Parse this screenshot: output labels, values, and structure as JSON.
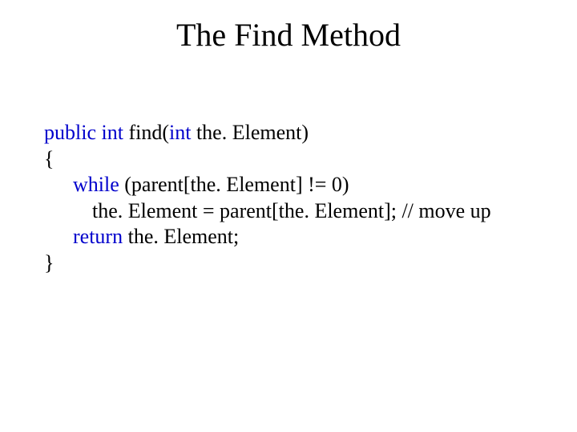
{
  "title": "The Find Method",
  "code": {
    "line1": {
      "kw_public": "public",
      "kw_int1": "int",
      "fn_name": "find(",
      "kw_int2": "int",
      "rest1": " the. Element)"
    },
    "line2": "{",
    "line3": {
      "kw_while": "while",
      "expr": " (parent[the. Element] != 0)"
    },
    "line4": "the. Element = parent[the. Element];  // move up",
    "line5": {
      "kw_return": "return",
      "expr": " the. Element;"
    },
    "line6": "}"
  }
}
